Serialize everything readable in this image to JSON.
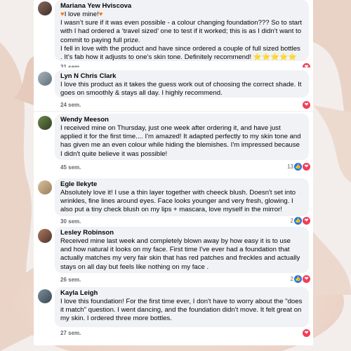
{
  "comments": [
    {
      "name": "Mariana Yew Hviscova",
      "first_line": "I love mine!",
      "body": "I wasn’t sure if it was even possible - a colour changing foundation??? So to start with I had ordered a ‘travel sized’ one to test if it worked; this is as I didn’t want to commit to paying full prize.",
      "body2": "I fell in love with the product and have since ordered a couple of full sized bottles . It’s fab how it adjusts to one’s skin tone. Definitely recommend!",
      "stars": "⭐⭐⭐⭐⭐",
      "time": "31 sem.",
      "count": ""
    },
    {
      "name": "Lyn N Chris Clark",
      "body": "I love this product as it takes the guess work out of choosing the correct shade. It goes on smoothly & stays all day. I highly recommend.",
      "time": "24 sem.",
      "count": ""
    },
    {
      "name": "Wendy Meeson",
      "body": "I received mine on Thursday, just one week after ordering it, and have just applied it for the first time.... I'm amazed! It adapted perfectly to my skin tone and has given me an even colour while hiding the blemishes. I'm impressed because I didn't quite believe it was possible!",
      "time": "45 sem.",
      "count": "13"
    },
    {
      "name": "Egle Ilekyte",
      "body": "Absolutely love it! I use a thin layer together with cheeck blush. Doesn't set into wrinkles, fine lines around eyes. Face looks younger and very fresh, glowing. I also put a tiny check blush on my lips + mascara, love myself in the mirror!",
      "time": "30 sem.",
      "count": "2"
    },
    {
      "name": "Lesley Robinson",
      "body": "Received mine last week and completely blown away by how easy it is to use and how natural it looks on my face. First time I've ever had a foundation that actually matches my very fair skin that has red patches and freckles and actually stays on all day but feels like nothing on my face .",
      "time": "26 sem.",
      "count": "2"
    },
    {
      "name": "Kayla Leigh",
      "body": "I love this foundation! For the first time ever, I don't have to worry about the \"does it match\" question. I went dancing, and the foundation didn't move. It felt great on my skin. I ordered three more bottles.",
      "time": "27 sem.",
      "count": ""
    }
  ],
  "icons": {
    "heart": "❤",
    "like": "👍"
  },
  "colors": {
    "heart": "#f33e58",
    "like": "#1877f2",
    "bubble": "#f0f2f5",
    "timestamp": "#65676b"
  }
}
